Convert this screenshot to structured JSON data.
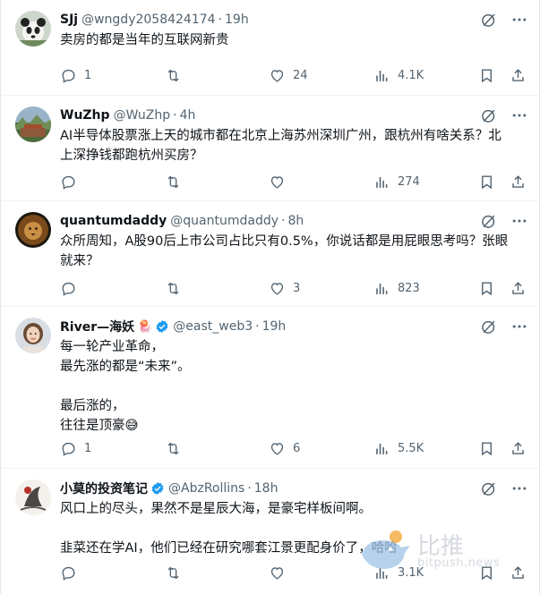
{
  "tweets": [
    {
      "name": "SJj",
      "handle": "@wngdy2058424174",
      "time": "19h",
      "lines": [
        "卖房的都是当年的互联网新贵"
      ],
      "replies": "1",
      "retweets": "",
      "likes": "24",
      "views": "4.1K",
      "avatar_icon": "avatar-panda-icon"
    },
    {
      "name": "WuZhp",
      "handle": "@WuZhp",
      "time": "4h",
      "lines": [
        "AI半导体股票涨上天的城市都在北京上海苏州深圳广州，跟杭州有啥关系？北",
        "上深挣钱都跑杭州买房？"
      ],
      "replies": "",
      "retweets": "",
      "likes": "",
      "views": "274",
      "avatar_icon": "avatar-landscape-icon"
    },
    {
      "name": "quantumdaddy",
      "handle": "@quantumdaddy",
      "time": "8h",
      "lines": [
        "众所周知，A股90后上市公司占比只有0.5%，你说话都是用屁眼思考吗？张眼",
        "就来？"
      ],
      "replies": "",
      "retweets": "",
      "likes": "3",
      "views": "823",
      "avatar_icon": "avatar-lion-icon"
    },
    {
      "name": "River—海妖",
      "name_emoji": "🪼",
      "handle": "@east_web3",
      "time": "19h",
      "lines": [
        "每一轮产业革命，",
        "最先涨的都是“未来”。",
        "",
        "最后涨的，",
        "往往是顶豪😅"
      ],
      "replies": "1",
      "retweets": "",
      "likes": "6",
      "views": "5.5K",
      "avatar_icon": "avatar-portrait-icon"
    },
    {
      "name": "小莫的投资笔记",
      "handle": "@AbzRollins",
      "time": "18h",
      "lines": [
        "风口上的尽头，果然不是星辰大海，是豪宅样板间啊。",
        "",
        "韭菜还在学AI，他们已经在研究哪套江景更配身价了，哈哈"
      ],
      "replies": "",
      "retweets": "",
      "likes": "",
      "views": "3.1K",
      "avatar_icon": "avatar-ink-icon"
    }
  ],
  "watermark": {
    "title": "比推",
    "subtitle": "bitpush.news"
  },
  "colors": {
    "text": "#0f1419",
    "muted": "#536471",
    "verified": "#1d9bf0",
    "divider": "#eff3f4"
  }
}
